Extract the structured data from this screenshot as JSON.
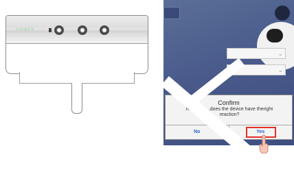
{
  "device": {
    "led_label": "POWER"
  },
  "phone": {
    "dialog": {
      "title": "Confirm",
      "message": "Registing...does the device have theright reaction?",
      "no_label": "No",
      "yes_label": "Yes"
    },
    "highlight_color": "#e3302a"
  },
  "icons": {
    "field_chevron": "chevron-down-icon",
    "hand": "hand-pointer-icon"
  }
}
